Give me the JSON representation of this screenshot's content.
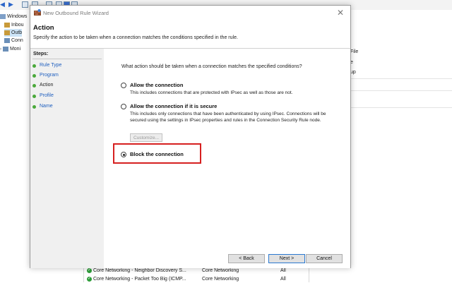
{
  "background": {
    "toolbar_icons": [
      "back-arrow-icon",
      "forward-arrow-icon",
      "folder-icon",
      "console-icon",
      "properties-icon",
      "document-icon",
      "help-icon",
      "list-icon"
    ],
    "tree": [
      {
        "label": "Windows",
        "icon": "firewall-icon"
      },
      {
        "label": "Inbou",
        "icon": "inbound-rules-icon"
      },
      {
        "label": "Outb",
        "icon": "outbound-rules-icon"
      },
      {
        "label": "Conn",
        "icon": "connection-security-icon"
      },
      {
        "label": "Moni",
        "icon": "monitoring-icon"
      }
    ],
    "actions_pane": [
      "File",
      "e",
      "up"
    ],
    "rows": [
      {
        "name": "Core Networking - Neighbor Discovery S...",
        "group": "Core Networking",
        "profile": "All"
      },
      {
        "name": "Core Networking - Packet Too Big (ICMP...",
        "group": "Core Networking",
        "profile": "All"
      }
    ]
  },
  "dialog": {
    "title": "New Outbound Rule Wizard",
    "heading": "Action",
    "subheading": "Specify the action to be taken when a connection matches the conditions specified in the rule.",
    "steps_title": "Steps:",
    "steps": [
      {
        "label": "Rule Type",
        "active": false
      },
      {
        "label": "Program",
        "active": false
      },
      {
        "label": "Action",
        "active": true
      },
      {
        "label": "Profile",
        "active": false
      },
      {
        "label": "Name",
        "active": false
      }
    ],
    "question": "What action should be taken when a connection matches the specified conditions?",
    "options": [
      {
        "label": "Allow the connection",
        "description": "This includes connections that are protected with IPsec as well as those are not.",
        "selected": false
      },
      {
        "label": "Allow the connection if it is secure",
        "description": "This includes only connections that have been authenticated by using IPsec.  Connections will be secured using the settings in IPsec properties and rules in the Connection Security Rule node.",
        "selected": false
      },
      {
        "label": "Block the connection",
        "description": "",
        "selected": true
      }
    ],
    "customize_label": "Customize...",
    "buttons": {
      "back": "< Back",
      "next": "Next >",
      "cancel": "Cancel"
    },
    "highlight_color": "#d62020",
    "step_dot_color": "#4aa93a",
    "link_color": "#1f5fbf"
  }
}
